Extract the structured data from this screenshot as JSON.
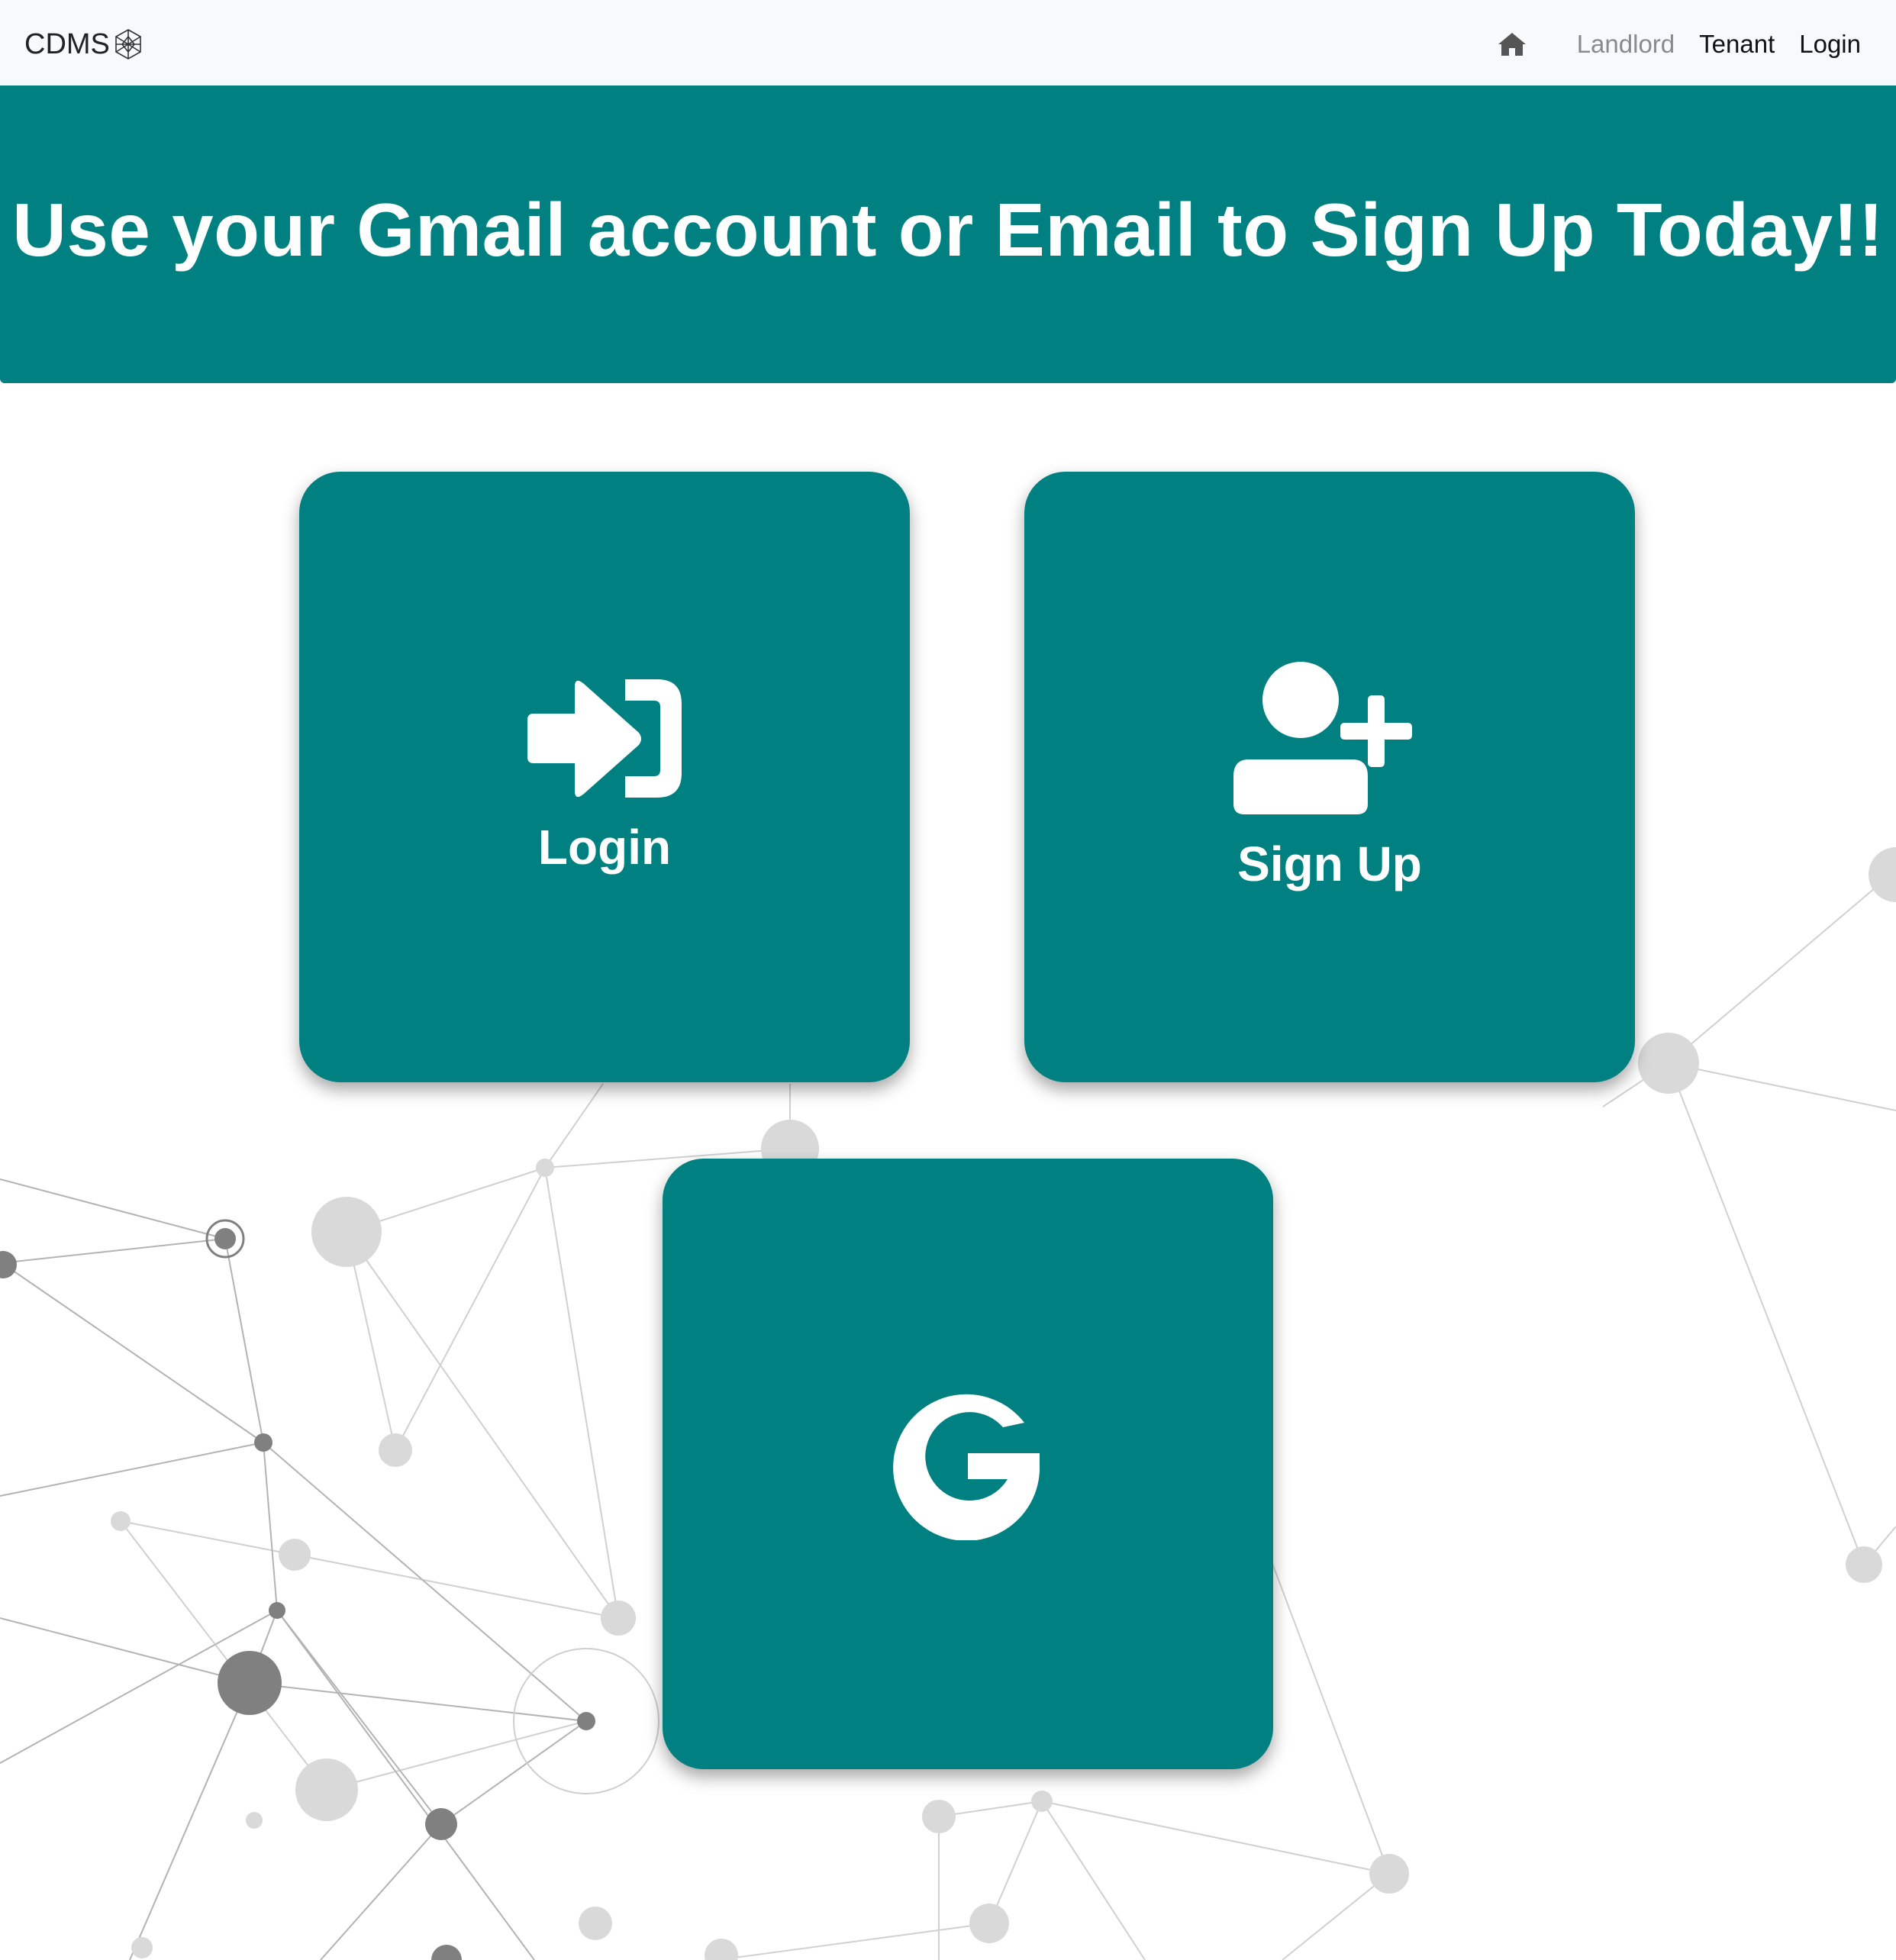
{
  "navbar": {
    "brand": "CDMS",
    "brand_icon": "crystal-globe-icon",
    "home_icon": "home-icon",
    "links": [
      {
        "label": "Landlord",
        "state": "muted"
      },
      {
        "label": "Tenant",
        "state": "active"
      },
      {
        "label": "Login",
        "state": "active"
      }
    ]
  },
  "banner": {
    "title": "Use your Gmail account or Email to Sign Up Today!!"
  },
  "cards": {
    "login": {
      "label": "Login",
      "icon": "sign-in-icon"
    },
    "signup": {
      "label": "Sign Up",
      "icon": "user-plus-icon"
    },
    "google": {
      "icon": "google-icon"
    }
  },
  "colors": {
    "accent": "#008080",
    "navbar_bg": "#f8f9fa",
    "text_on_accent": "#ffffff"
  }
}
